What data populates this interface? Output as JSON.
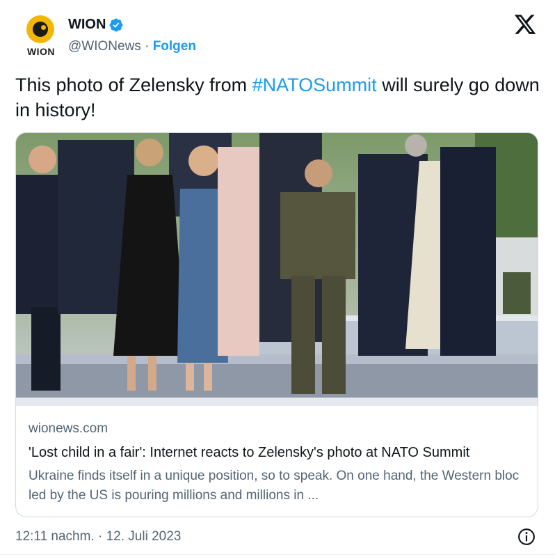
{
  "header": {
    "avatar_word": "WION",
    "display_name": "WION",
    "handle": "@WIONews",
    "separator": " · ",
    "follow_label": "Folgen"
  },
  "tweet": {
    "text_before": "This photo of Zelensky from ",
    "hashtag": "#NATOSummit",
    "text_after": " will surely go down in history!"
  },
  "card": {
    "domain": "wionews.com",
    "title": "'Lost child in a fair': Internet reacts to Zelensky's photo at NATO Summit",
    "description": "Ukraine finds itself in a unique position, so to speak. On one hand, the Western bloc led by the US is pouring millions and millions in ..."
  },
  "footer": {
    "timestamp": "12:11 nachm. · 12. Juli 2023"
  },
  "colors": {
    "accent": "#1d9bf0",
    "verified": "#1d9bf0",
    "brand_yellow": "#f2b705",
    "muted_text": "#536471"
  },
  "icons": {
    "verified": "verified-badge-icon",
    "platform": "x-logo-icon",
    "info": "info-icon"
  }
}
